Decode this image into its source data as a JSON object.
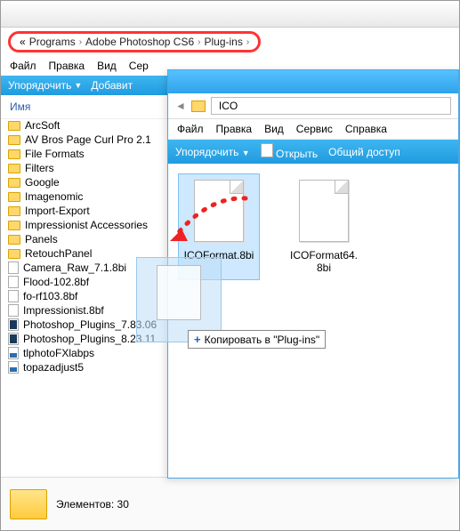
{
  "window1": {
    "breadcrumb": [
      "Programs",
      "Adobe Photoshop CS6",
      "Plug-ins"
    ],
    "menu": [
      "Файл",
      "Правка",
      "Вид",
      "Сер"
    ],
    "toolbar": {
      "organize": "Упорядочить",
      "add": "Добавит"
    },
    "column_header": "Имя",
    "items": [
      {
        "name": "ArcSoft",
        "type": "folder"
      },
      {
        "name": "AV Bros Page Curl Pro 2.1",
        "type": "folder"
      },
      {
        "name": "File Formats",
        "type": "folder"
      },
      {
        "name": "Filters",
        "type": "folder"
      },
      {
        "name": "Google",
        "type": "folder"
      },
      {
        "name": "Imagenomic",
        "type": "folder"
      },
      {
        "name": "Import-Export",
        "type": "folder"
      },
      {
        "name": "Impressionist Accessories",
        "type": "folder"
      },
      {
        "name": "Panels",
        "type": "folder"
      },
      {
        "name": "RetouchPanel",
        "type": "folder"
      },
      {
        "name": "Camera_Raw_7.1.8bi",
        "type": "file"
      },
      {
        "name": "Flood-102.8bf",
        "type": "file"
      },
      {
        "name": "fo-rf103.8bf",
        "type": "file"
      },
      {
        "name": "Impressionist.8bf",
        "type": "file"
      },
      {
        "name": "Photoshop_Plugins_7.83.06",
        "type": "ps"
      },
      {
        "name": "Photoshop_Plugins_8.23.11",
        "type": "ps"
      },
      {
        "name": "tlphotoFXlabps",
        "type": "exe"
      },
      {
        "name": "topazadjust5",
        "type": "exe"
      }
    ],
    "footer": {
      "count_label": "Элементов:",
      "count": "30"
    }
  },
  "window2": {
    "folder_name": "ICO",
    "menu": [
      "Файл",
      "Правка",
      "Вид",
      "Сервис",
      "Справка"
    ],
    "toolbar": {
      "organize": "Упорядочить",
      "open": "Открыть",
      "share": "Общий доступ"
    },
    "files": [
      {
        "name": "ICOFormat.8bi",
        "selected": true
      },
      {
        "name": "ICOFormat64.8bi",
        "selected": false
      }
    ]
  },
  "drag": {
    "ghost_label": "",
    "tooltip_prefix": "+",
    "tooltip_text": "Копировать в \"Plug-ins\""
  }
}
